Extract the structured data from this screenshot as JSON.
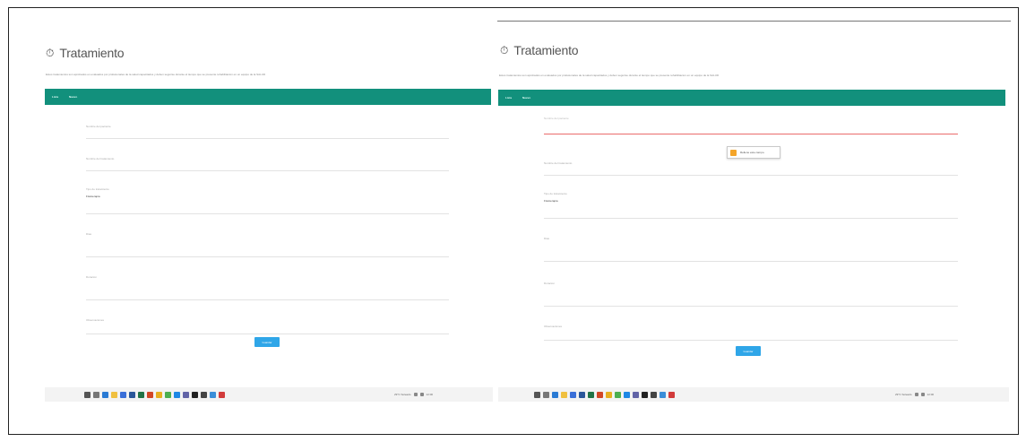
{
  "left_panel": {
    "title": "Tratamiento",
    "title_icon": "stopwatch-icon",
    "description": "Estos tratamientos son aprobados en evaluados por profesionales de la salud capacitados y deben seguirse durante el tiempo que se presente rehabilitacion en un equipo de la SALUD",
    "bar_items": [
      "Lista",
      "Nuevo"
    ],
    "fields": [
      {
        "label": "Nombre del paciente",
        "value": ""
      },
      {
        "label": "Nombre del tratamiento",
        "value": ""
      },
      {
        "label": "Tipo de tratamiento",
        "value": "Fisioterapia"
      },
      {
        "label": "Dias",
        "value": ""
      },
      {
        "label": "Duracion",
        "value": ""
      },
      {
        "label": "Observaciones",
        "value": ""
      }
    ],
    "submit_label": "Guardar"
  },
  "right_panel": {
    "title": "Tratamiento",
    "title_icon": "stopwatch-icon",
    "description": "Estos tratamientos son aprobados en evaluados por profesionales de la salud capacitados y deben seguirse durante el tiempo que se presente rehabilitacion en un equipo de la SALUD",
    "bar_items": [
      "Lista",
      "Nuevo"
    ],
    "fields": [
      {
        "label": "Nombre del paciente",
        "value": ""
      },
      {
        "label": "Nombre del tratamiento",
        "value": ""
      },
      {
        "label": "Tipo de tratamiento",
        "value": "Fisioterapia"
      },
      {
        "label": "Dias",
        "value": ""
      },
      {
        "label": "Duracion",
        "value": ""
      },
      {
        "label": "Observaciones",
        "value": ""
      }
    ],
    "validation_message": "Rellene este campo.",
    "submit_label": "Guardar"
  },
  "taskbar": {
    "icons": [
      "search-icon",
      "task-view-icon",
      "edge-icon",
      "explorer-icon",
      "store-icon",
      "word-icon",
      "excel-icon",
      "powerpoint-icon",
      "folder-icon",
      "chrome-icon",
      "vscode-icon",
      "teams-icon",
      "terminal-icon",
      "settings-icon",
      "mail-icon",
      "app-icon"
    ],
    "tray_text": "29°C Soleado",
    "clock": "12:00"
  },
  "colors": {
    "header_bar": "#12907c",
    "button": "#2fa6e8",
    "error_line": "#ea6c6c",
    "warning": "#f4a52a"
  }
}
